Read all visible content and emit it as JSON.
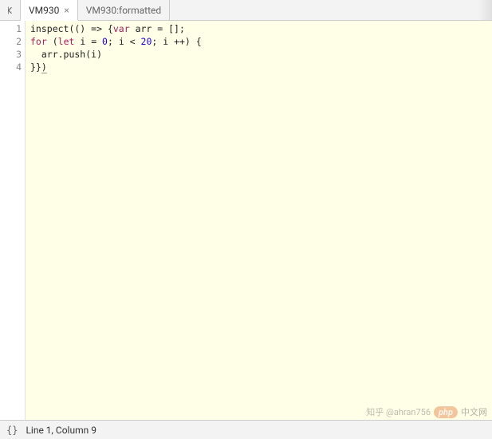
{
  "tabs": [
    {
      "label": "VM930",
      "active": true,
      "closable": true
    },
    {
      "label": "VM930:formatted",
      "active": false,
      "closable": false
    }
  ],
  "code": {
    "lines": [
      {
        "n": "1",
        "segments": [
          {
            "t": "inspect(() => {",
            "c": ""
          },
          {
            "t": "var",
            "c": "kw"
          },
          {
            "t": " arr = [];",
            "c": ""
          }
        ]
      },
      {
        "n": "2",
        "segments": [
          {
            "t": "for",
            "c": "kw"
          },
          {
            "t": " (",
            "c": ""
          },
          {
            "t": "let",
            "c": "kw"
          },
          {
            "t": " i = ",
            "c": ""
          },
          {
            "t": "0",
            "c": "num"
          },
          {
            "t": "; i < ",
            "c": ""
          },
          {
            "t": "20",
            "c": "num"
          },
          {
            "t": "; i ++) {",
            "c": ""
          }
        ]
      },
      {
        "n": "3",
        "segments": [
          {
            "t": "  arr.push(i)",
            "c": ""
          }
        ]
      },
      {
        "n": "4",
        "segments": [
          {
            "t": "}}",
            "c": ""
          },
          {
            "t": ")",
            "c": "underline"
          }
        ]
      }
    ]
  },
  "status": {
    "brackets": "{}",
    "position": "Line 1, Column 9"
  },
  "watermark": {
    "zhihu": "知乎 @ahran756",
    "php": "php",
    "cn": "中文网"
  }
}
